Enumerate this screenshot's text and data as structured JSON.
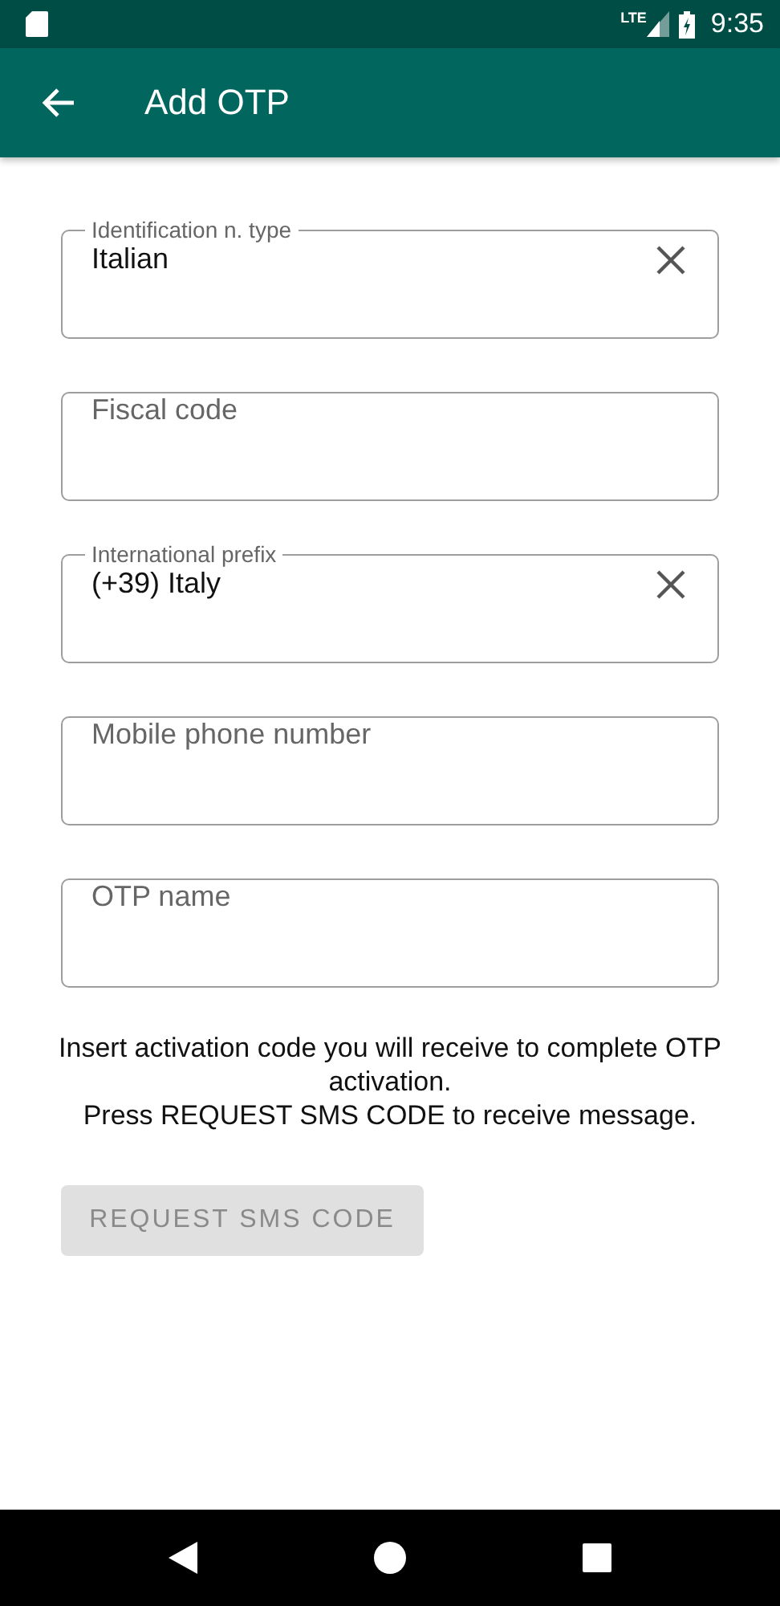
{
  "status_bar": {
    "network": "LTE",
    "time": "9:35"
  },
  "app_bar": {
    "title": "Add OTP"
  },
  "fields": [
    {
      "label": "Identification n. type",
      "value": "Italian",
      "clearable": true
    },
    {
      "placeholder": "Fiscal code",
      "clearable": false
    },
    {
      "label": "International prefix",
      "value": "(+39) Italy",
      "clearable": true
    },
    {
      "placeholder": "Mobile phone number",
      "clearable": false
    },
    {
      "placeholder": "OTP name",
      "clearable": false
    }
  ],
  "message": [
    "Insert activation code you will receive to complete OTP activation.",
    "Press REQUEST SMS CODE to receive message."
  ],
  "button": {
    "label": "REQUEST SMS CODE",
    "disabled": true
  }
}
